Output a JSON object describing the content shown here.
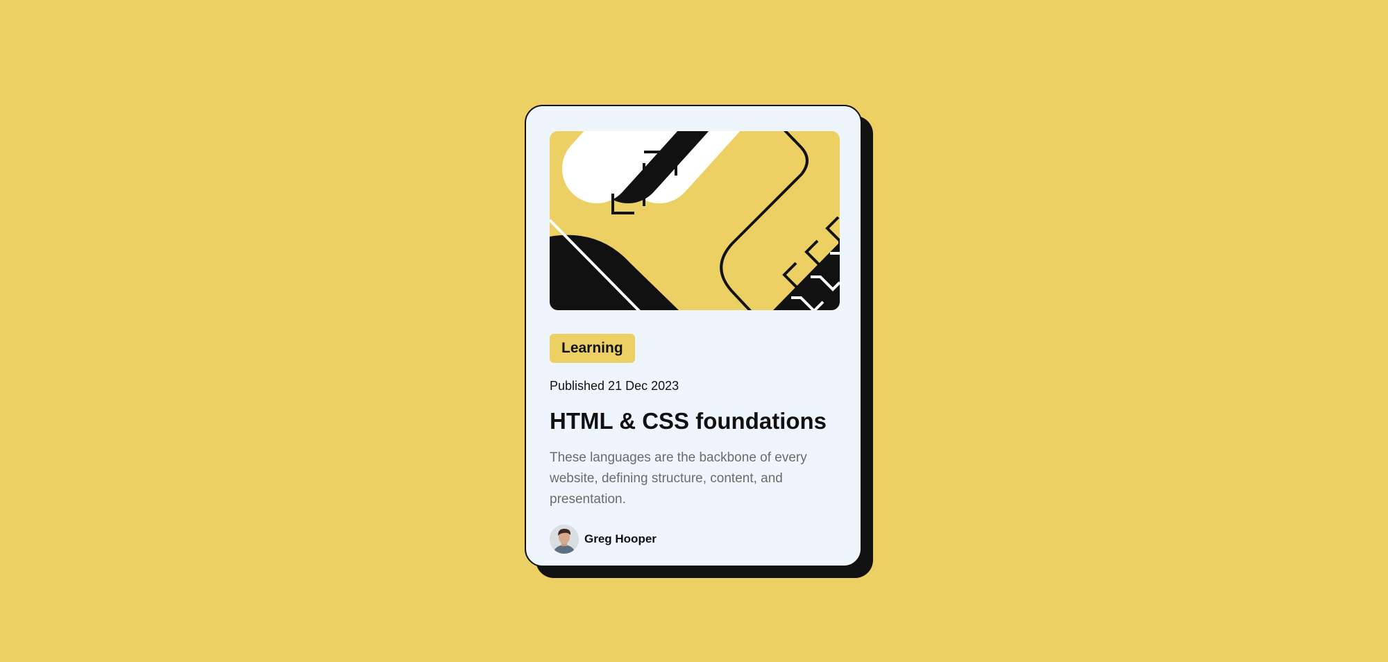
{
  "page": {
    "background_color": "#ECD063"
  },
  "card": {
    "background_color": "#EFF5FC",
    "border_color": "#111111",
    "hero_image": "abstract-geometric-illustration",
    "tag": "Learning",
    "published": "Published 21 Dec 2023",
    "title": "HTML & CSS foundations",
    "description": "These languages are the backbone of every website, defining structure, content, and presentation.",
    "author": {
      "name": "Greg Hooper",
      "avatar": "author-portrait"
    }
  }
}
